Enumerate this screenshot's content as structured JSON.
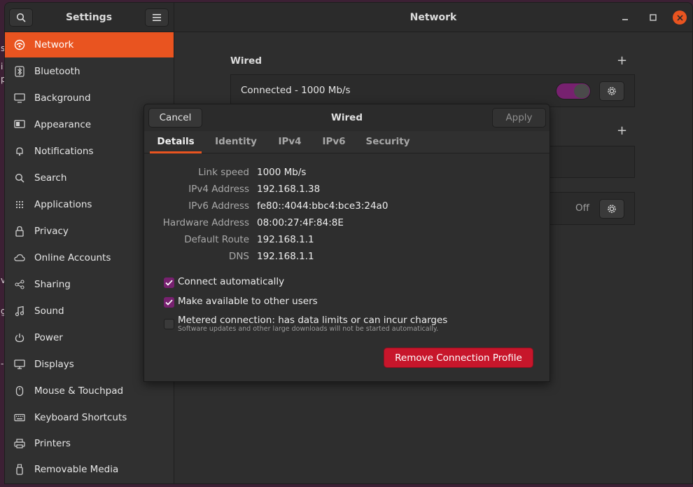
{
  "desktop": {
    "fragments": [
      "s",
      "i",
      "p",
      "v",
      "g",
      "-"
    ]
  },
  "sidebar_header": {
    "title": "Settings"
  },
  "main_header": {
    "title": "Network"
  },
  "sidebar": {
    "items": [
      {
        "label": "Network",
        "icon": "network-icon",
        "active": true
      },
      {
        "label": "Bluetooth",
        "icon": "bluetooth-icon"
      },
      {
        "label": "Background",
        "icon": "monitor-icon"
      },
      {
        "label": "Appearance",
        "icon": "appearance-icon"
      },
      {
        "label": "Notifications",
        "icon": "bell-icon"
      },
      {
        "label": "Search",
        "icon": "search-icon"
      },
      {
        "label": "Applications",
        "icon": "grid-icon"
      },
      {
        "label": "Privacy",
        "icon": "lock-icon"
      },
      {
        "label": "Online Accounts",
        "icon": "cloud-icon"
      },
      {
        "label": "Sharing",
        "icon": "share-icon"
      },
      {
        "label": "Sound",
        "icon": "music-note-icon"
      },
      {
        "label": "Power",
        "icon": "power-icon"
      },
      {
        "label": "Displays",
        "icon": "display-icon"
      },
      {
        "label": "Mouse & Touchpad",
        "icon": "mouse-icon"
      },
      {
        "label": "Keyboard Shortcuts",
        "icon": "keyboard-icon"
      },
      {
        "label": "Printers",
        "icon": "printer-icon"
      },
      {
        "label": "Removable Media",
        "icon": "usb-icon"
      }
    ]
  },
  "main": {
    "wired_title": "Wired",
    "wired_status": "Connected - 1000 Mb/s",
    "off_label": "Off"
  },
  "dialog": {
    "title": "Wired",
    "cancel_label": "Cancel",
    "apply_label": "Apply",
    "tabs": [
      "Details",
      "Identity",
      "IPv4",
      "IPv6",
      "Security"
    ],
    "details": [
      {
        "key": "Link speed",
        "value": "1000 Mb/s"
      },
      {
        "key": "IPv4 Address",
        "value": "192.168.1.38"
      },
      {
        "key": "IPv6 Address",
        "value": "fe80::4044:bbc4:bce3:24a0"
      },
      {
        "key": "Hardware Address",
        "value": "08:00:27:4F:84:8E"
      },
      {
        "key": "Default Route",
        "value": "192.168.1.1"
      },
      {
        "key": "DNS",
        "value": "192.168.1.1"
      }
    ],
    "connect_auto": {
      "label": "Connect automatically",
      "checked": true
    },
    "available_all": {
      "label": "Make available to other users",
      "checked": true
    },
    "metered": {
      "label": "Metered connection: has data limits or can incur charges",
      "sublabel": "Software updates and other large downloads will not be started automatically.",
      "checked": false
    },
    "remove_label": "Remove Connection Profile"
  },
  "colors": {
    "accent": "#e95420",
    "toggle": "#77216f",
    "destructive": "#c7162b"
  }
}
